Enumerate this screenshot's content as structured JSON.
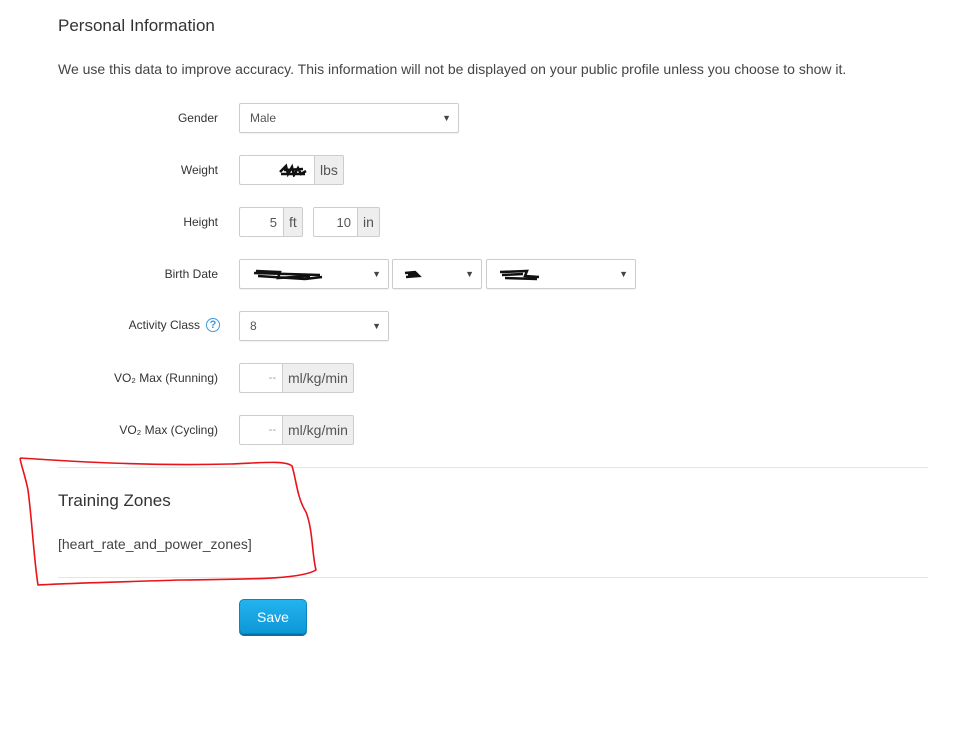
{
  "personal_info": {
    "title": "Personal Information",
    "intro": "We use this data to improve accuracy. This information will not be displayed on your public profile unless you choose to show it."
  },
  "fields": {
    "gender": {
      "label": "Gender",
      "value": "Male"
    },
    "weight": {
      "label": "Weight",
      "unit": "lbs"
    },
    "height": {
      "label": "Height",
      "feet": "5",
      "feet_unit": "ft",
      "inches": "10",
      "inches_unit": "in"
    },
    "birth_date": {
      "label": "Birth Date"
    },
    "activity_class": {
      "label": "Activity Class",
      "help": "?",
      "value": "8"
    },
    "vo2_running": {
      "label": "VO₂ Max (Running)",
      "value": "--",
      "unit": "ml/kg/min"
    },
    "vo2_cycling": {
      "label": "VO₂ Max (Cycling)",
      "value": "--",
      "unit": "ml/kg/min"
    }
  },
  "training_zones": {
    "title": "Training Zones",
    "placeholder": "[heart_rate_and_power_zones]"
  },
  "save_label": "Save",
  "colors": {
    "accent": "#1aa9e6",
    "annotation": "#e8141b",
    "help_icon": "#3a9bd9"
  }
}
